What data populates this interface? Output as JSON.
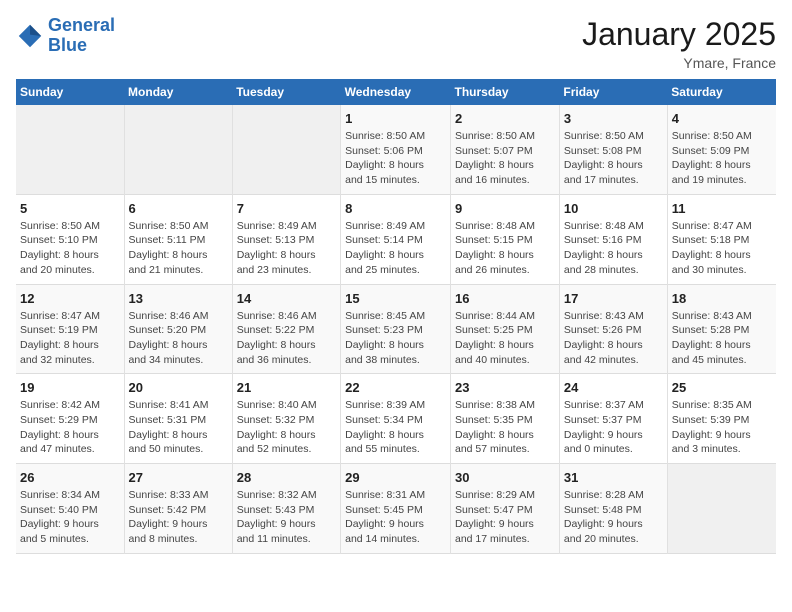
{
  "header": {
    "logo_line1": "General",
    "logo_line2": "Blue",
    "month_year": "January 2025",
    "location": "Ymare, France"
  },
  "weekdays": [
    "Sunday",
    "Monday",
    "Tuesday",
    "Wednesday",
    "Thursday",
    "Friday",
    "Saturday"
  ],
  "weeks": [
    [
      {
        "day": "",
        "info": ""
      },
      {
        "day": "",
        "info": ""
      },
      {
        "day": "",
        "info": ""
      },
      {
        "day": "1",
        "info": "Sunrise: 8:50 AM\nSunset: 5:06 PM\nDaylight: 8 hours\nand 15 minutes."
      },
      {
        "day": "2",
        "info": "Sunrise: 8:50 AM\nSunset: 5:07 PM\nDaylight: 8 hours\nand 16 minutes."
      },
      {
        "day": "3",
        "info": "Sunrise: 8:50 AM\nSunset: 5:08 PM\nDaylight: 8 hours\nand 17 minutes."
      },
      {
        "day": "4",
        "info": "Sunrise: 8:50 AM\nSunset: 5:09 PM\nDaylight: 8 hours\nand 19 minutes."
      }
    ],
    [
      {
        "day": "5",
        "info": "Sunrise: 8:50 AM\nSunset: 5:10 PM\nDaylight: 8 hours\nand 20 minutes."
      },
      {
        "day": "6",
        "info": "Sunrise: 8:50 AM\nSunset: 5:11 PM\nDaylight: 8 hours\nand 21 minutes."
      },
      {
        "day": "7",
        "info": "Sunrise: 8:49 AM\nSunset: 5:13 PM\nDaylight: 8 hours\nand 23 minutes."
      },
      {
        "day": "8",
        "info": "Sunrise: 8:49 AM\nSunset: 5:14 PM\nDaylight: 8 hours\nand 25 minutes."
      },
      {
        "day": "9",
        "info": "Sunrise: 8:48 AM\nSunset: 5:15 PM\nDaylight: 8 hours\nand 26 minutes."
      },
      {
        "day": "10",
        "info": "Sunrise: 8:48 AM\nSunset: 5:16 PM\nDaylight: 8 hours\nand 28 minutes."
      },
      {
        "day": "11",
        "info": "Sunrise: 8:47 AM\nSunset: 5:18 PM\nDaylight: 8 hours\nand 30 minutes."
      }
    ],
    [
      {
        "day": "12",
        "info": "Sunrise: 8:47 AM\nSunset: 5:19 PM\nDaylight: 8 hours\nand 32 minutes."
      },
      {
        "day": "13",
        "info": "Sunrise: 8:46 AM\nSunset: 5:20 PM\nDaylight: 8 hours\nand 34 minutes."
      },
      {
        "day": "14",
        "info": "Sunrise: 8:46 AM\nSunset: 5:22 PM\nDaylight: 8 hours\nand 36 minutes."
      },
      {
        "day": "15",
        "info": "Sunrise: 8:45 AM\nSunset: 5:23 PM\nDaylight: 8 hours\nand 38 minutes."
      },
      {
        "day": "16",
        "info": "Sunrise: 8:44 AM\nSunset: 5:25 PM\nDaylight: 8 hours\nand 40 minutes."
      },
      {
        "day": "17",
        "info": "Sunrise: 8:43 AM\nSunset: 5:26 PM\nDaylight: 8 hours\nand 42 minutes."
      },
      {
        "day": "18",
        "info": "Sunrise: 8:43 AM\nSunset: 5:28 PM\nDaylight: 8 hours\nand 45 minutes."
      }
    ],
    [
      {
        "day": "19",
        "info": "Sunrise: 8:42 AM\nSunset: 5:29 PM\nDaylight: 8 hours\nand 47 minutes."
      },
      {
        "day": "20",
        "info": "Sunrise: 8:41 AM\nSunset: 5:31 PM\nDaylight: 8 hours\nand 50 minutes."
      },
      {
        "day": "21",
        "info": "Sunrise: 8:40 AM\nSunset: 5:32 PM\nDaylight: 8 hours\nand 52 minutes."
      },
      {
        "day": "22",
        "info": "Sunrise: 8:39 AM\nSunset: 5:34 PM\nDaylight: 8 hours\nand 55 minutes."
      },
      {
        "day": "23",
        "info": "Sunrise: 8:38 AM\nSunset: 5:35 PM\nDaylight: 8 hours\nand 57 minutes."
      },
      {
        "day": "24",
        "info": "Sunrise: 8:37 AM\nSunset: 5:37 PM\nDaylight: 9 hours\nand 0 minutes."
      },
      {
        "day": "25",
        "info": "Sunrise: 8:35 AM\nSunset: 5:39 PM\nDaylight: 9 hours\nand 3 minutes."
      }
    ],
    [
      {
        "day": "26",
        "info": "Sunrise: 8:34 AM\nSunset: 5:40 PM\nDaylight: 9 hours\nand 5 minutes."
      },
      {
        "day": "27",
        "info": "Sunrise: 8:33 AM\nSunset: 5:42 PM\nDaylight: 9 hours\nand 8 minutes."
      },
      {
        "day": "28",
        "info": "Sunrise: 8:32 AM\nSunset: 5:43 PM\nDaylight: 9 hours\nand 11 minutes."
      },
      {
        "day": "29",
        "info": "Sunrise: 8:31 AM\nSunset: 5:45 PM\nDaylight: 9 hours\nand 14 minutes."
      },
      {
        "day": "30",
        "info": "Sunrise: 8:29 AM\nSunset: 5:47 PM\nDaylight: 9 hours\nand 17 minutes."
      },
      {
        "day": "31",
        "info": "Sunrise: 8:28 AM\nSunset: 5:48 PM\nDaylight: 9 hours\nand 20 minutes."
      },
      {
        "day": "",
        "info": ""
      }
    ]
  ]
}
